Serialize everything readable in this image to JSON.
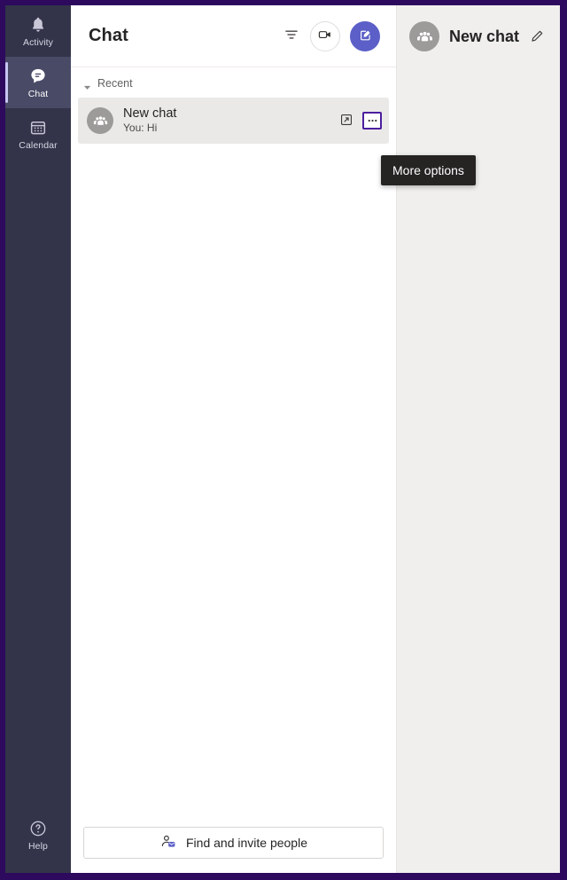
{
  "window": {
    "frame_color": "#2d0a5e",
    "accent_color": "#5b5fc7",
    "highlight_border_color": "#4b1f9e"
  },
  "rail": {
    "items": [
      {
        "label": "Activity",
        "icon": "bell-icon",
        "active": false
      },
      {
        "label": "Chat",
        "icon": "chat-bubble-icon",
        "active": true
      },
      {
        "label": "Calendar",
        "icon": "calendar-icon",
        "active": false
      }
    ],
    "help": {
      "label": "Help",
      "icon": "question-circle-icon"
    }
  },
  "list_panel": {
    "title": "Chat",
    "actions": {
      "filter": "filter-icon",
      "video_call": "video-camera-icon",
      "compose": "compose-pencil-icon"
    },
    "section": {
      "label": "Recent",
      "chevron": "chevron-down-icon"
    },
    "chats": [
      {
        "name": "New chat",
        "preview": "You: Hi",
        "avatar_icon": "group-people-icon",
        "selected": true,
        "row_actions": {
          "popout": "pop-out-icon",
          "more": "more-options-ellipsis-icon"
        }
      }
    ],
    "footer": {
      "invite_label": "Find and invite people",
      "invite_icon": "person-mail-icon"
    }
  },
  "tooltip": {
    "text": "More options"
  },
  "right_panel": {
    "title": "New chat",
    "avatar_icon": "group-people-icon",
    "edit_icon": "pencil-icon"
  }
}
